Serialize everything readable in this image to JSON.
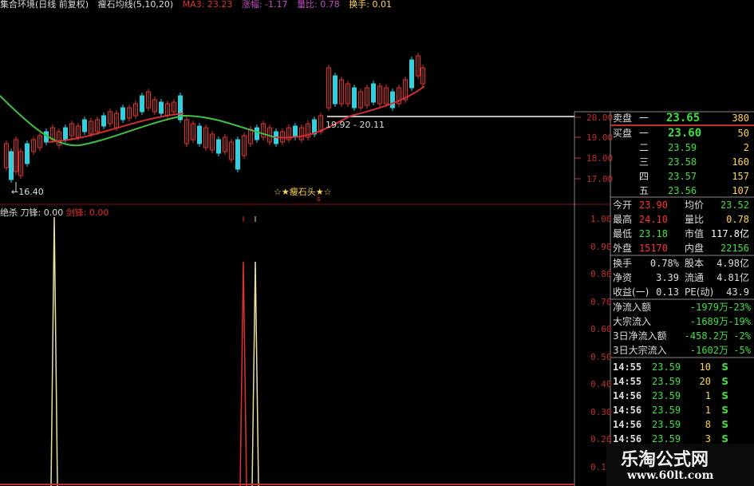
{
  "colors": {
    "up": "#e03030",
    "down": "#30d0e0",
    "ma5": "#e0e0e0",
    "ma_red": "#d03030",
    "ma_green": "#40c040",
    "grid": "#8a1010",
    "yellow": "#ffd54a",
    "green": "#40e040",
    "red": "#ff3030",
    "white": "#ffffff"
  },
  "top_bar": {
    "title": "集合环境(日线 前复权)",
    "indicator": "瘦石均线(5,10,20)",
    "ma3": "MA3: 23.23",
    "delta": "涨幅: -1.17",
    "vol_ratio": "量比: 0.78",
    "turnover": "换手: 0.01"
  },
  "kline": {
    "price_axis": [
      "20.00",
      "19.00",
      "18.00",
      "17.00"
    ],
    "low_label": "←16.40",
    "range_label": "19.92 - 20.11",
    "pattern_label": "☆★瘦石头★☆",
    "pattern_mark": "s"
  },
  "indicator": {
    "title": "绝杀",
    "field1": "刀锋: 0.00",
    "field2": "剑锋: 0.00",
    "axis": [
      "1.00",
      "0.90",
      "0.80",
      "0.70",
      "0.60",
      "0.50",
      "0.40",
      "0.30",
      "0.20",
      "0.10"
    ]
  },
  "quote": {
    "ask": {
      "label": "卖盘",
      "level": "一",
      "price": "23.65",
      "vol": "380"
    },
    "bid": [
      {
        "label": "买盘",
        "level": "一",
        "price": "23.60",
        "vol": "50"
      },
      {
        "label": "",
        "level": "二",
        "price": "23.59",
        "vol": "2"
      },
      {
        "label": "",
        "level": "三",
        "price": "23.58",
        "vol": "160"
      },
      {
        "label": "",
        "level": "四",
        "price": "23.57",
        "vol": "157"
      },
      {
        "label": "",
        "level": "五",
        "price": "23.56",
        "vol": "107"
      }
    ],
    "stats": [
      {
        "k1": "今开",
        "v1": "23.90",
        "c1": "red",
        "k2": "均价",
        "v2": "23.52",
        "c2": "green"
      },
      {
        "k1": "最高",
        "v1": "24.10",
        "c1": "red",
        "k2": "量比",
        "v2": "0.78",
        "c2": "yellow"
      },
      {
        "k1": "最低",
        "v1": "23.18",
        "c1": "green",
        "k2": "市值",
        "v2": "117.8亿",
        "c2": "white"
      },
      {
        "k1": "外盘",
        "v1": "15170",
        "c1": "red",
        "k2": "内盘",
        "v2": "22156",
        "c2": "green"
      }
    ],
    "fund": [
      {
        "k1": "换手",
        "v1": "0.78%",
        "k2": "股本",
        "v2": "4.98亿"
      },
      {
        "k1": "净资",
        "v1": "3.39",
        "k2": "流通",
        "v2": "4.81亿"
      },
      {
        "k1": "收益(一)",
        "v1": "0.13",
        "k2": "PE(动)",
        "v2": "43.9"
      }
    ],
    "flows": [
      {
        "k": "净流入额",
        "v": "-1979万",
        "p": "-23%"
      },
      {
        "k": "大宗流入",
        "v": "-1689万",
        "p": "-19%"
      },
      {
        "k": "3日净流入额",
        "v": "-458.2万",
        "p": "-2%"
      },
      {
        "k": "3日大宗流入",
        "v": "-1602万",
        "p": "-5%"
      }
    ],
    "ticks": [
      {
        "t": "14:55",
        "p": "23.59",
        "v": "10",
        "s": "S"
      },
      {
        "t": "14:55",
        "p": "23.59",
        "v": "20",
        "s": "S"
      },
      {
        "t": "14:56",
        "p": "23.59",
        "v": "1",
        "s": "S"
      },
      {
        "t": "14:56",
        "p": "23.59",
        "v": "1",
        "s": "S"
      },
      {
        "t": "14:56",
        "p": "23.59",
        "v": "8",
        "s": "S"
      },
      {
        "t": "14:56",
        "p": "23.59",
        "v": "3",
        "s": "S"
      }
    ]
  },
  "watermark": {
    "line1": "乐淘公式网",
    "line2": "www.60lt.com"
  }
}
